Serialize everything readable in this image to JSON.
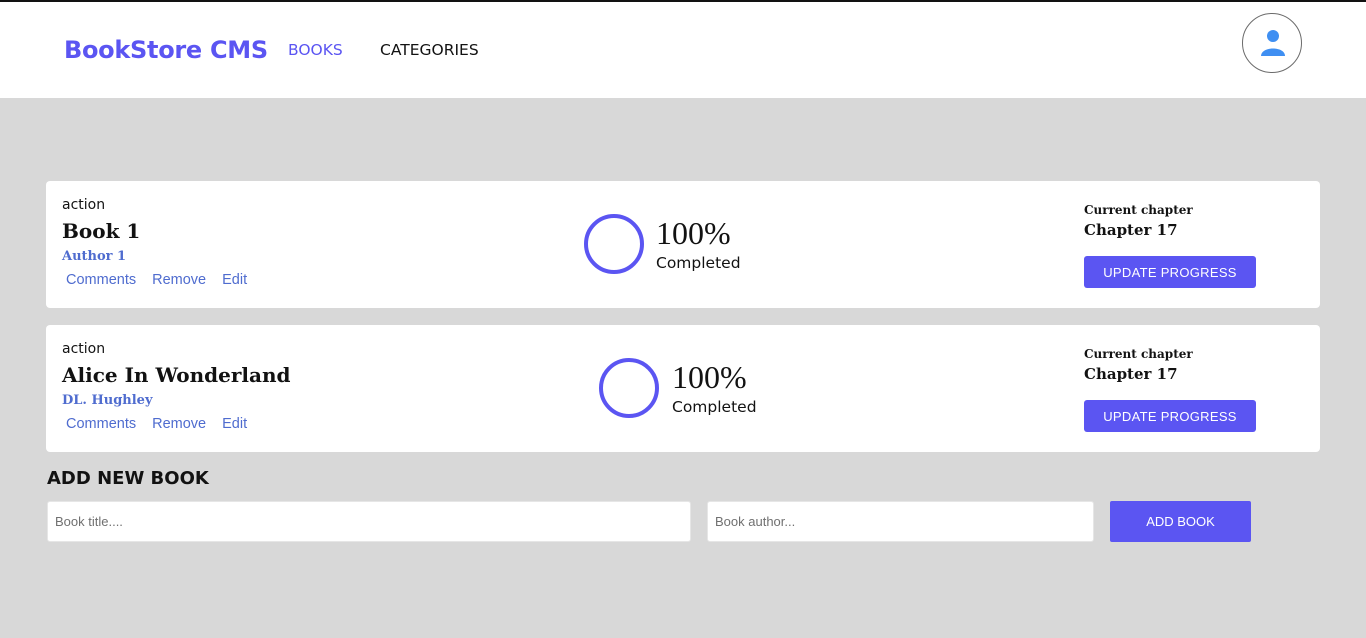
{
  "header": {
    "brand": "BookStore CMS",
    "nav": [
      {
        "label": "BOOKS",
        "active": true
      },
      {
        "label": "CATEGORIES",
        "active": false
      }
    ],
    "avatar_icon": "user-icon"
  },
  "books": [
    {
      "genre": "action",
      "title": "Book 1",
      "author": "Author 1",
      "actions": [
        "Comments",
        "Remove",
        "Edit"
      ],
      "percent": "100%",
      "completed_label": "Completed",
      "current_chapter_label": "Current chapter",
      "current_chapter": "Chapter 17",
      "update_label": "UPDATE PROGRESS"
    },
    {
      "genre": "action",
      "title": "Alice In Wonderland",
      "author": "DL. Hughley",
      "actions": [
        "Comments",
        "Remove",
        "Edit"
      ],
      "percent": "100%",
      "completed_label": "Completed",
      "current_chapter_label": "Current chapter",
      "current_chapter": "Chapter 17",
      "update_label": "UPDATE PROGRESS"
    }
  ],
  "add_book": {
    "heading": "ADD NEW BOOK",
    "title_placeholder": "Book title....",
    "author_placeholder": "Book author...",
    "button_label": "ADD BOOK"
  },
  "colors": {
    "accent": "#5b55f2",
    "link": "#4f6ccf",
    "background": "#d8d8d8"
  }
}
